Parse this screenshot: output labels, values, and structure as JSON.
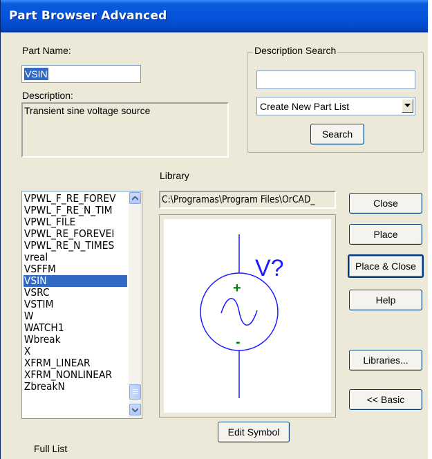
{
  "window": {
    "title": "Part Browser Advanced"
  },
  "part_name": {
    "label": "Part Name:",
    "value": "VSIN"
  },
  "description": {
    "label": "Description:",
    "value": "Transient sine voltage source"
  },
  "description_search": {
    "group_label": "Description Search",
    "input_value": "",
    "dropdown_selected": "Create New Part List",
    "search_button": "Search"
  },
  "library": {
    "label": "Library",
    "path": "C:\\Programas\\Program Files\\OrCAD_"
  },
  "parts_list": {
    "items": [
      "VPWL_F_RE_FOREV",
      "VPWL_F_RE_N_TIM",
      "VPWL_FILE",
      "VPWL_RE_FOREVEI",
      "VPWL_RE_N_TIMES",
      "vreal",
      "VSFFM",
      "VSIN",
      "VSRC",
      "VSTIM",
      "W",
      "WATCH1",
      "Wbreak",
      "X",
      "XFRM_LINEAR",
      "XFRM_NONLINEAR",
      "ZbreakN"
    ],
    "selected": "VSIN"
  },
  "symbol_preview": {
    "ref_label": "V?",
    "plus": "+",
    "minus": "-"
  },
  "buttons": {
    "close": "Close",
    "place": "Place",
    "place_close": "Place & Close",
    "help": "Help",
    "libraries": "Libraries...",
    "basic": "<< Basic",
    "edit_symbol": "Edit Symbol"
  },
  "footer": {
    "full_list": "Full List"
  },
  "colors": {
    "titlebar": "#0554dc",
    "selection": "#316ac5",
    "symbol": "#1c1cff",
    "pin_marks": "#008000"
  }
}
